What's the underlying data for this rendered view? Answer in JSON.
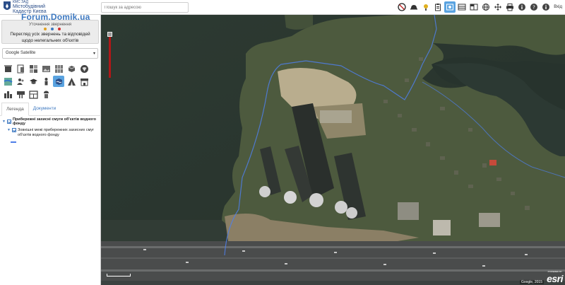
{
  "header": {
    "brand_small": "КМС ЗАД",
    "brand_line1": "Містобудівний",
    "brand_line2": "Кадастр Києва",
    "watermark": "Forum.Domik.ua",
    "search_placeholder": "Пошук за адресою",
    "login_label": "Вхід",
    "toolbar": [
      {
        "name": "no-entry-icon",
        "active": false
      },
      {
        "name": "hard-hat-icon",
        "active": false
      },
      {
        "name": "lightbulb-icon",
        "active": false
      },
      {
        "name": "clipboard-icon",
        "active": false
      },
      {
        "name": "photo-layer-icon",
        "active": true
      },
      {
        "name": "panels-icon",
        "active": false
      },
      {
        "name": "compare-icon",
        "active": false
      },
      {
        "name": "globe-icon",
        "active": false
      },
      {
        "name": "pan-arrows-icon",
        "active": false
      },
      {
        "name": "print-icon",
        "active": false
      },
      {
        "name": "info-icon",
        "active": false
      },
      {
        "name": "help-icon",
        "active": false
      },
      {
        "name": "info-alt-icon",
        "active": false
      }
    ]
  },
  "sidebar": {
    "layer_card_title": "Уточнення звернення",
    "layer_card_text": "Перегляд усіх звернень та відповідей щодо нелегальних об'єктів",
    "dot_colors": [
      "#e0a020",
      "#3d78c0",
      "#d03030"
    ],
    "basemap_value": "Google Satellite",
    "layer_buttons": [
      {
        "name": "buildings-layer-icon",
        "active": false
      },
      {
        "name": "document-layer-icon",
        "active": false
      },
      {
        "name": "blocks-layer-icon",
        "active": false
      },
      {
        "name": "photo-layer-icon",
        "active": false
      },
      {
        "name": "grid-layer-icon",
        "active": false
      },
      {
        "name": "cube-layer-icon",
        "active": false
      },
      {
        "name": "shield-layer-icon",
        "active": false
      },
      {
        "name": "map-layer-icon",
        "active": false
      },
      {
        "name": "people-layer-icon",
        "active": false
      },
      {
        "name": "education-layer-icon",
        "active": false
      },
      {
        "name": "person-layer-icon",
        "active": false
      },
      {
        "name": "water-zone-layer-icon",
        "active": true
      },
      {
        "name": "tent-layer-icon",
        "active": false
      },
      {
        "name": "shop-layer-icon",
        "active": false
      },
      {
        "name": "city-layer-icon",
        "active": false
      },
      {
        "name": "sign-layer-icon",
        "active": false
      },
      {
        "name": "store-layer-icon",
        "active": false
      },
      {
        "name": "worker-layer-icon",
        "active": false
      }
    ],
    "tabs": [
      "Легенда",
      "Документи"
    ],
    "legend_title": "Прибережні захисні смуги об'єктів водного фонду",
    "legend_item": "Зовнішні межі прибережних захисних смуг об'єктів водного фонду",
    "legend_color": "#4f7fe8"
  },
  "map": {
    "attribution": "Google, 2015",
    "esri_label": "esri",
    "esri_powered": "POWERED BY"
  }
}
